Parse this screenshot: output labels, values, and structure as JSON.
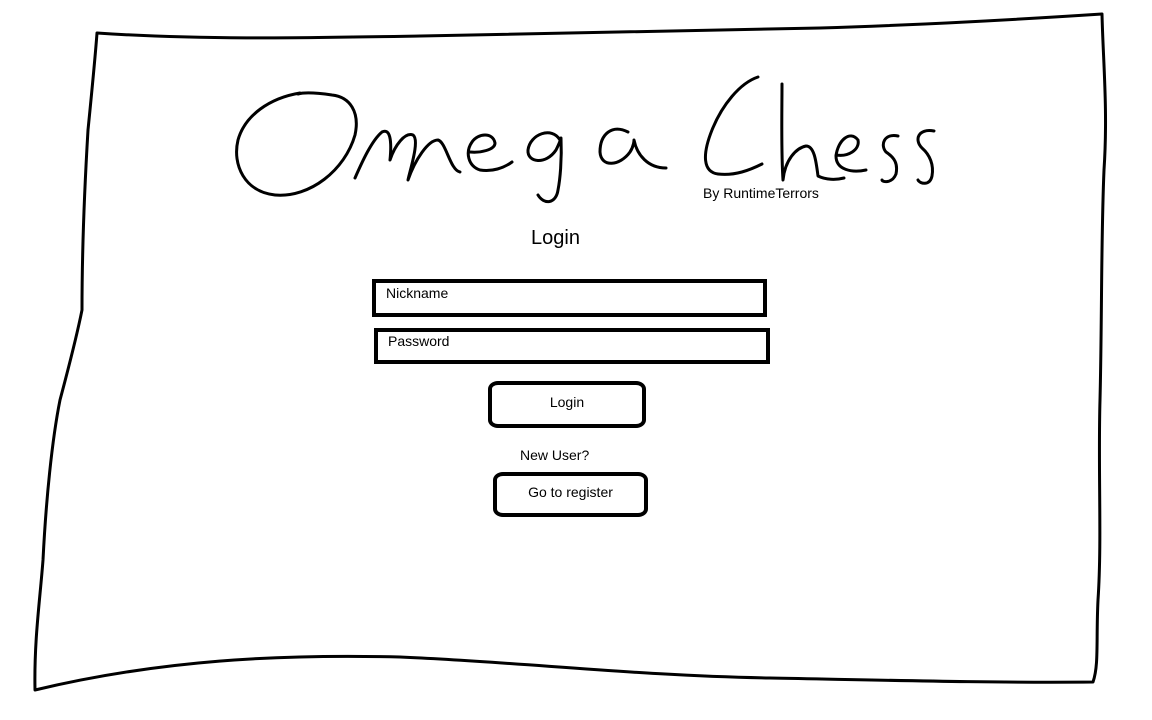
{
  "app": {
    "logo_text": "Omega Chess",
    "byline": "By RuntimeTerrors"
  },
  "login": {
    "heading": "Login",
    "nickname_placeholder": "Nickname",
    "password_placeholder": "Password",
    "login_button": "Login",
    "new_user_text": "New User?",
    "register_button": "Go to register"
  }
}
